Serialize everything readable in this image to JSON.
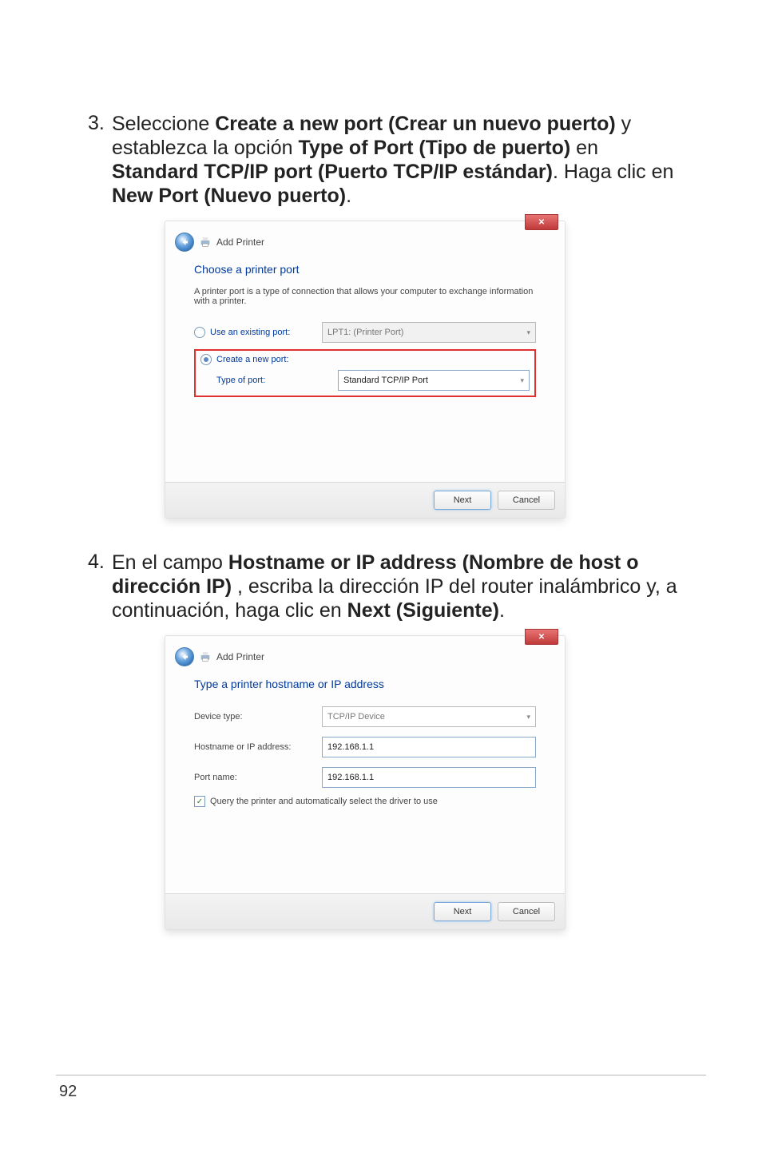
{
  "pageNumber": "92",
  "step3": {
    "num": "3.",
    "pre": "Seleccione ",
    "b1": "Create a new port (Crear un nuevo puerto)",
    "mid1": " y establezca la opción ",
    "b2": "Type of Port (Tipo de puerto)",
    "mid2": " en ",
    "b3": "Standard TCP/IP port (Puerto TCP/IP estándar)",
    "mid3": ". Haga clic en ",
    "b4": "New Port (Nuevo puerto)",
    "tail": "."
  },
  "step4": {
    "num": "4.",
    "pre": "En el campo ",
    "b1": "Hostname or IP address (Nombre de host o dirección IP)",
    "mid1": " , escriba la dirección IP del router inalámbrico y, a continuación, haga clic en ",
    "b2": "Next (Siguiente)",
    "tail": "."
  },
  "dlg1": {
    "title": "Add Printer",
    "section": "Choose a printer port",
    "desc": "A printer port is a type of connection that allows your computer to exchange information with a printer.",
    "useExisting": "Use an existing port:",
    "lpt": "LPT1: (Printer Port)",
    "createNew": "Create a new port:",
    "typeOfPort": "Type of port:",
    "portValue": "Standard TCP/IP Port",
    "next": "Next",
    "cancel": "Cancel"
  },
  "dlg2": {
    "title": "Add Printer",
    "section": "Type a printer hostname or IP address",
    "deviceType": "Device type:",
    "deviceValue": "TCP/IP Device",
    "hostLabel": "Hostname or IP address:",
    "hostValue": "192.168.1.1",
    "portLabel": "Port name:",
    "portValue": "192.168.1.1",
    "query": "Query the printer and automatically select the driver to use",
    "next": "Next",
    "cancel": "Cancel"
  },
  "icons": {
    "closeX": "✕",
    "check": "✓"
  }
}
